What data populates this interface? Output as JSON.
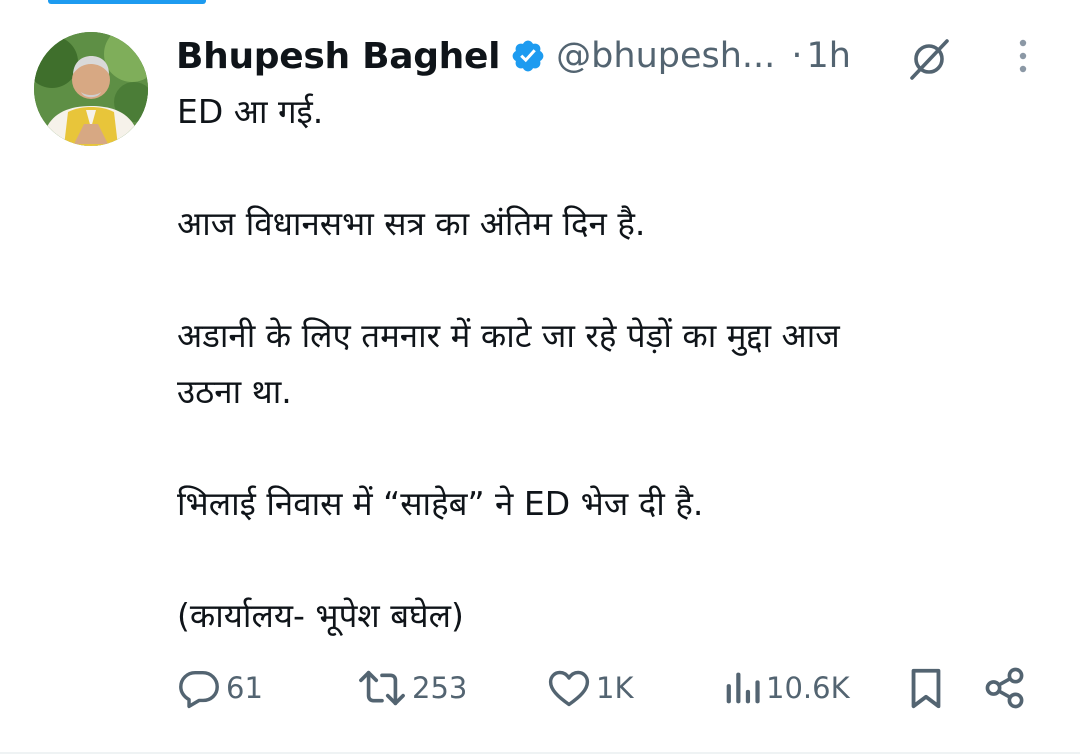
{
  "tweet": {
    "author_name": "Bhupesh Baghel",
    "handle": "@bhupesh...",
    "separator": "·",
    "time": "1h",
    "paragraphs": [
      [
        "ED आ गई."
      ],
      [
        "आज विधानसभा सत्र का अंतिम दिन है."
      ],
      [
        "अडानी के लिए तमनार में काटे जा रहे पेड़ों का मुद्दा आज",
        "उठना था."
      ],
      [
        "भिलाई निवास में “साहेब” ने ED भेज दी है."
      ],
      [
        "(कार्यालय- भूपेश बघेल)"
      ]
    ]
  },
  "actions": {
    "replies": "61",
    "reposts": "253",
    "likes": "1K",
    "views": "10.6K"
  },
  "colors": {
    "text": "#0f1419",
    "secondary": "#536471",
    "verified": "#1d9bf0",
    "accent": "#1d9bf0"
  },
  "icons": {
    "verified": "verified-badge-icon",
    "grok": "grok-icon",
    "more": "more-vertical-icon",
    "reply": "reply-icon",
    "repost": "repost-icon",
    "like": "heart-icon",
    "views": "views-icon",
    "bookmark": "bookmark-icon",
    "share": "share-icon"
  }
}
